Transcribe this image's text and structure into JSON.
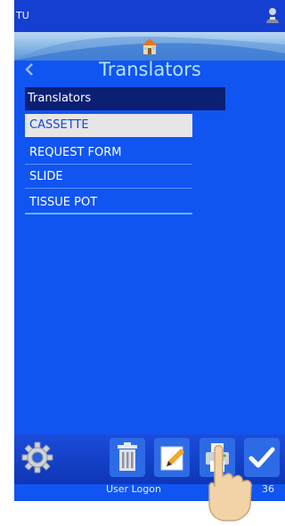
{
  "status": {
    "left_text": "TU"
  },
  "header": {
    "title": "Translators"
  },
  "list": {
    "header_label": "Translators",
    "items": [
      {
        "label": "CASSETTE",
        "selected": true
      },
      {
        "label": "REQUEST FORM",
        "selected": false
      },
      {
        "label": "SLIDE",
        "selected": false
      },
      {
        "label": "TISSUE POT",
        "selected": false
      }
    ]
  },
  "footer": {
    "user_label": "User Logon",
    "right_label": "36"
  },
  "icons": {
    "user": "user-icon",
    "home": "home-icon",
    "back": "chevron-left-icon",
    "settings": "gear-icon",
    "delete": "trash-icon",
    "edit": "pencil-icon",
    "print": "printer-icon",
    "confirm": "checkmark-icon"
  },
  "colors": {
    "screen_bg": "#1055f2",
    "list_header_bg": "#0b1f73",
    "selected_bg": "#e6e6e6",
    "title": "#b6e1ff"
  }
}
